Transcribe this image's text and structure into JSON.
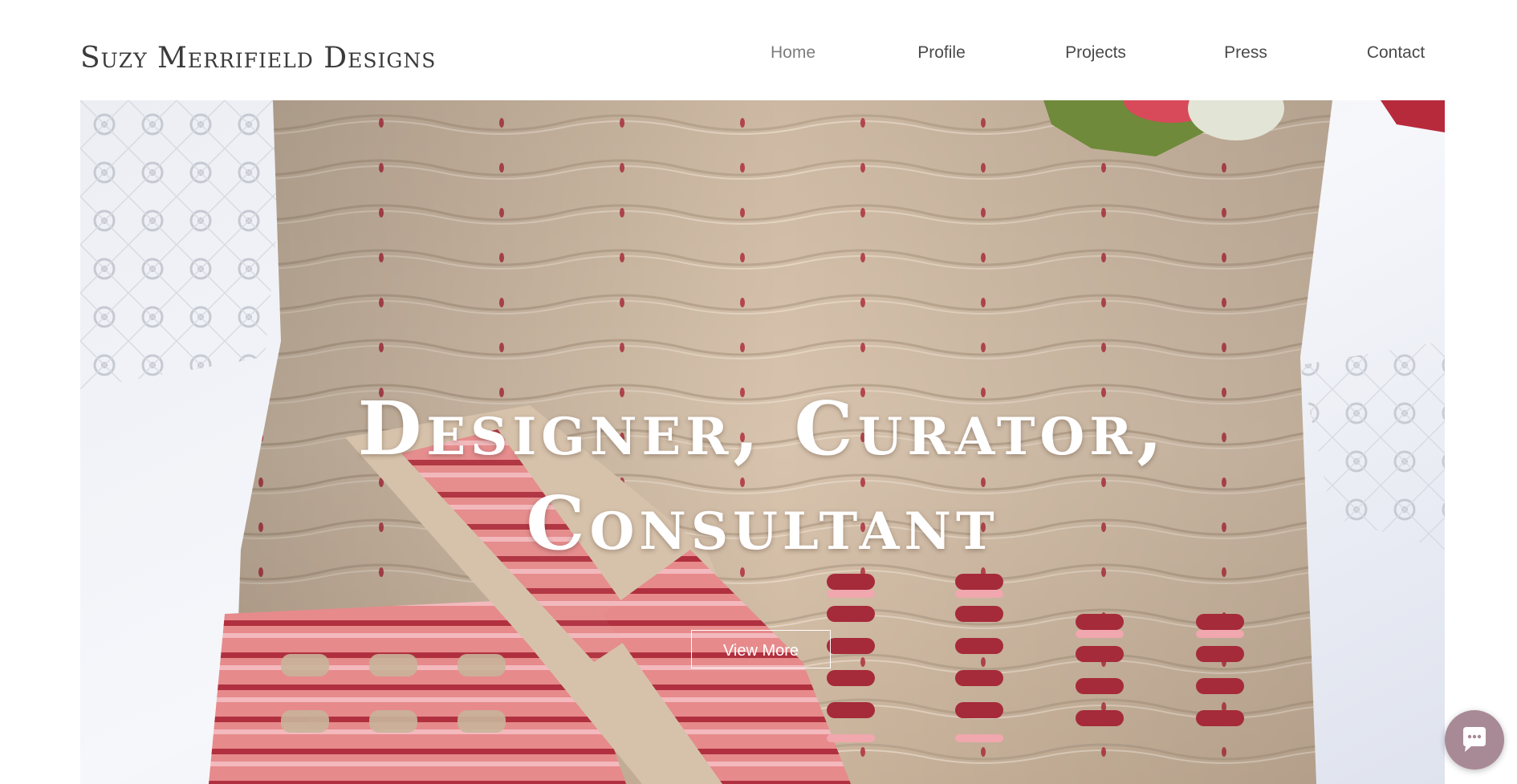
{
  "header": {
    "logo": "Suzy Merrifield Designs",
    "nav": [
      {
        "label": "Home",
        "active": true
      },
      {
        "label": "Profile",
        "active": false
      },
      {
        "label": "Projects",
        "active": false
      },
      {
        "label": "Press",
        "active": false
      },
      {
        "label": "Contact",
        "active": false
      }
    ]
  },
  "hero": {
    "title_line1": "Designer, Curator,",
    "title_line2": "Consultant",
    "button_label": "View More"
  },
  "chat": {
    "icon": "chat-bubble-icon",
    "color": "#a88a96"
  },
  "colors": {
    "text": "#3b3b3b",
    "nav_active": "#7d7d7d",
    "knit_beige": "#d9c6b0",
    "knit_pink": "#e07c80",
    "knit_red": "#b0303f",
    "cloth_white": "#eef0f6"
  }
}
